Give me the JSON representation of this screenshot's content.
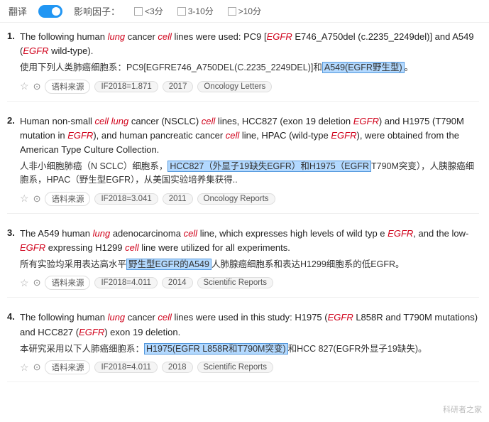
{
  "topbar": {
    "translate_label": "翻译",
    "impact_label": "影响因子：",
    "filters": [
      {
        "label": "<3分",
        "checked": false
      },
      {
        "label": "3-10分",
        "checked": false
      },
      {
        ">10分": "false",
        "label": ">10分",
        "checked": false
      }
    ]
  },
  "entries": [
    {
      "index": "1.",
      "en": "The following human lung cancer cell lines were used: PC9 [EGFR E746_A750del (c.2235_2249del)] and A549 (EGFR wild-type).",
      "zh": "使用下列人类肺癌细胞系：PC9[EGFRE746_A750DEL(C.2235_2249DEL)]和A549(EGFR野生型)。",
      "highlight_zh": "A549(EGFR野生型)",
      "if_year": "IF2018=1.871",
      "year": "2017",
      "journal": "Oncology Letters"
    },
    {
      "index": "2.",
      "en": "Human non-small cell lung cancer (NSCLC) cell lines, HCC827 (exon 19 deletion EGFR) and H1975 (T790M mutation in EGFR), and human pancreatic cancer cell line, HPAC (wild-type EGFR), were obtained from the American Type Culture Collection.",
      "zh": "人非小细胞肺癌（N SCLC）细胞系，HCC827（外显子19缺失EGFR）和H1975（EGFR T790M突变），人胰腺癌细胞系，HPAC（野生型EGFR），从美国实验培养集获得..",
      "highlight_zh": "HCC827（外显子19缺失EGFR）和H1975（EGFR",
      "if_year": "IF2018=3.041",
      "year": "2011",
      "journal": "Oncology Reports"
    },
    {
      "index": "3.",
      "en": "The A549 human lung adenocarcinoma cell line, which expresses high levels of wild type EGFR, and the low-EGFR expressing H1299 cell line were utilized for all experiments.",
      "zh": "所有实验均采用表达高水平野生型EGFR的A549人肺腺癌细胞系和表达H1299细胞系的低EGFR。",
      "highlight_zh": "野生型EGFR的A549",
      "if_year": "IF2018=4.011",
      "year": "2014",
      "journal": "Scientific Reports"
    },
    {
      "index": "4.",
      "en": "The following human lung cancer cell lines were used in this study: H1975 (EGFR L858R and T790M mutations) and HCC827 (EGFR exon 19 deletion.",
      "zh": "本研究采用以下人肺癌细胞系：H1975(EGFR L858R和T790M突变)和HCC 827(EGFR外显子19缺失)。",
      "highlight_zh": "H1975(EGFR L858R和T790M突变)",
      "if_year": "IF2018=4.011",
      "year": "2018",
      "journal": "Scientific Reports"
    }
  ],
  "watermark": "科研者之家"
}
